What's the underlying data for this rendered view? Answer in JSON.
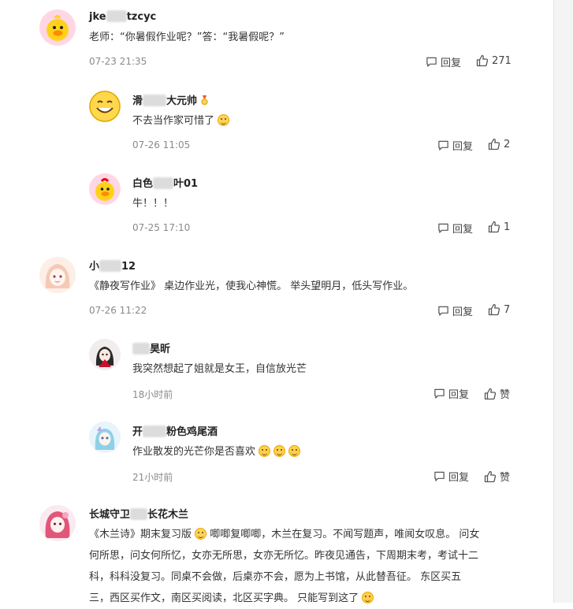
{
  "comments": [
    {
      "name_a": "jke",
      "name_b": "tzcyc",
      "text": "老师：“你暑假作业呢？”答：“我暑假呢？”",
      "time": "07-23 21:35",
      "reply": "回复",
      "likes": "271"
    },
    {
      "name_a": "滑",
      "name_b": "大元帅",
      "text": "不去当作家可惜了",
      "time": "07-26 11:05",
      "reply": "回复",
      "likes": "2"
    },
    {
      "name_a": "白色",
      "name_b": "叶01",
      "text": "牛！！！",
      "time": "07-25 17:10",
      "reply": "回复",
      "likes": "1"
    },
    {
      "name_a": "小",
      "name_b": "12",
      "text": "《静夜写作业》 桌边作业光，使我心神慌。 举头望明月，低头写作业。",
      "time": "07-26 11:22",
      "reply": "回复",
      "likes": "7"
    },
    {
      "name_a": "",
      "name_b": "昊昕",
      "text": "我突然想起了姐就是女王，自信放光芒",
      "time": "18小时前",
      "reply": "回复",
      "likes": "赞"
    },
    {
      "name_a": "开",
      "name_b": "粉色鸡尾酒",
      "text": "作业散发的光芒你是否喜欢",
      "time": "21小时前",
      "reply": "回复",
      "likes": "赞"
    },
    {
      "name_a": "长城守卫",
      "name_b": "长花木兰",
      "lines": [
        "《木兰诗》期末复习版",
        "唧唧复唧唧，木兰在复习。不闻写题声，唯闻女叹息。 问女",
        "何所思，问女何所忆，女亦无所思，女亦无所忆。昨夜见通告，下周期末考，考试十二",
        "科，科科没复习。同桌不会做，后桌亦不会，愿为上书馆，从此替吾征。 东区买五",
        "三，西区买作文，南区买阅读，北区买字典。 只能写到这了"
      ]
    }
  ],
  "icons": {
    "reply": "comment-icon",
    "like": "thumb-up-icon",
    "emoji": "smile-emoji-icon",
    "medal": "medal-icon"
  },
  "colors": {
    "meta": "#8a8a8a",
    "text": "#333333",
    "accent": "#ffd35a"
  }
}
